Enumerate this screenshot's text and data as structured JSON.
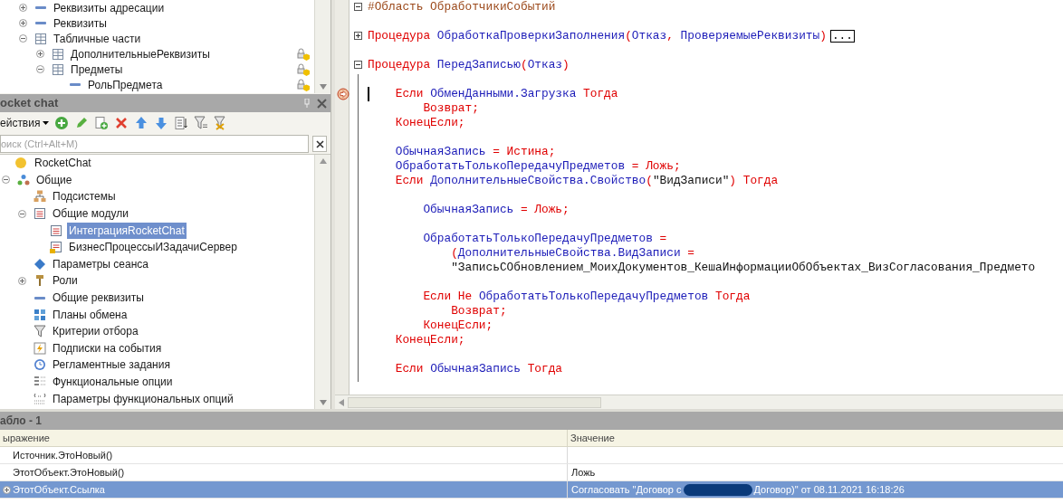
{
  "metadata_tree": {
    "items": [
      {
        "label": "Реквизиты адресации",
        "kind": "attribute",
        "expanded": false
      },
      {
        "label": "Реквизиты",
        "kind": "attribute",
        "expanded": false
      },
      {
        "label": "Табличные части",
        "kind": "table",
        "expanded": true,
        "children": [
          {
            "label": "ДополнительныеРеквизиты",
            "kind": "table",
            "expanded": false,
            "locked": true
          },
          {
            "label": "Предметы",
            "kind": "table",
            "expanded": true,
            "locked": true,
            "children": [
              {
                "label": "РольПредмета",
                "kind": "attribute",
                "locked": true
              }
            ]
          }
        ]
      }
    ]
  },
  "rocket_panel": {
    "title": "ocket chat",
    "actions_menu": "ействия",
    "search": {
      "placeholder": "оиск (Ctrl+Alt+M)"
    },
    "tree": [
      {
        "label": "RocketChat",
        "kind": "config",
        "selected": false,
        "children": [
          {
            "label": "Общие",
            "kind": "common",
            "expanded": true,
            "selected": false,
            "children": [
              {
                "label": "Подсистемы",
                "kind": "subsystems",
                "selected": false
              },
              {
                "label": "Общие модули",
                "kind": "module",
                "expanded": true,
                "selected": false,
                "children": [
                  {
                    "label": "ИнтеграцияRocketChat",
                    "kind": "module",
                    "selected": true
                  },
                  {
                    "label": "БизнесПроцессыИЗадачиСервер",
                    "kind": "module-server",
                    "selected": false
                  }
                ]
              },
              {
                "label": "Параметры сеанса",
                "kind": "session",
                "selected": false
              },
              {
                "label": "Роли",
                "kind": "role",
                "expanded": false,
                "selected": false
              },
              {
                "label": "Общие реквизиты",
                "kind": "attribute",
                "selected": false
              },
              {
                "label": "Планы обмена",
                "kind": "exchange",
                "selected": false
              },
              {
                "label": "Критерии отбора",
                "kind": "filter",
                "selected": false
              },
              {
                "label": "Подписки на события",
                "kind": "event",
                "selected": false
              },
              {
                "label": "Регламентные задания",
                "kind": "clock",
                "selected": false
              },
              {
                "label": "Функциональные опции",
                "kind": "options",
                "selected": false
              },
              {
                "label": "Параметры функциональных опций",
                "kind": "option-params",
                "selected": false
              }
            ]
          }
        ]
      }
    ]
  },
  "code_editor": {
    "lines": [
      {
        "kind": "code",
        "folded": false,
        "tokens": [
          {
            "kind": "region",
            "text": "#Область ОбработчикиСобытий"
          }
        ]
      },
      {
        "kind": "blank"
      },
      {
        "kind": "code",
        "folded": true,
        "tokens": [
          {
            "kind": "keyword",
            "text": "Процедура "
          },
          {
            "kind": "name",
            "text": "ОбработкаПроверкиЗаполнения"
          },
          {
            "kind": "keyword",
            "text": "("
          },
          {
            "kind": "name",
            "text": "Отказ"
          },
          {
            "kind": "keyword",
            "text": ", "
          },
          {
            "kind": "name",
            "text": "ПроверяемыеРеквизиты"
          },
          {
            "kind": "keyword",
            "text": ")"
          },
          {
            "kind": "collapsed",
            "text": "..."
          }
        ]
      },
      {
        "kind": "blank"
      },
      {
        "kind": "code",
        "folded": false,
        "tokens": [
          {
            "kind": "keyword",
            "text": "Процедура "
          },
          {
            "kind": "name",
            "text": "ПередЗаписью"
          },
          {
            "kind": "keyword",
            "text": "("
          },
          {
            "kind": "name",
            "text": "Отказ"
          },
          {
            "kind": "keyword",
            "text": ")"
          }
        ]
      },
      {
        "kind": "blank"
      },
      {
        "kind": "code",
        "breakpoint": true,
        "cursor": true,
        "tokens": [
          {
            "kind": "keyword",
            "text": "    Если "
          },
          {
            "kind": "name",
            "text": "ОбменДанными.Загрузка"
          },
          {
            "kind": "keyword",
            "text": " Тогда"
          }
        ]
      },
      {
        "kind": "code",
        "tokens": [
          {
            "kind": "keyword",
            "text": "        Возврат;"
          }
        ]
      },
      {
        "kind": "code",
        "tokens": [
          {
            "kind": "keyword",
            "text": "    КонецЕсли;"
          }
        ]
      },
      {
        "kind": "blank"
      },
      {
        "kind": "code",
        "tokens": [
          {
            "kind": "name",
            "text": "    ОбычнаяЗапись"
          },
          {
            "kind": "keyword",
            "text": " = Истина;"
          }
        ]
      },
      {
        "kind": "code",
        "tokens": [
          {
            "kind": "name",
            "text": "    ОбработатьТолькоПередачуПредметов"
          },
          {
            "kind": "keyword",
            "text": " = Ложь;"
          }
        ]
      },
      {
        "kind": "code",
        "tokens": [
          {
            "kind": "keyword",
            "text": "    Если "
          },
          {
            "kind": "name",
            "text": "ДополнительныеСвойства.Свойство"
          },
          {
            "kind": "keyword",
            "text": "("
          },
          {
            "kind": "string",
            "text": "\"ВидЗаписи\""
          },
          {
            "kind": "keyword",
            "text": ") Тогда"
          }
        ]
      },
      {
        "kind": "blank"
      },
      {
        "kind": "code",
        "tokens": [
          {
            "kind": "name",
            "text": "        ОбычнаяЗапись"
          },
          {
            "kind": "keyword",
            "text": " = Ложь;"
          }
        ]
      },
      {
        "kind": "blank"
      },
      {
        "kind": "code",
        "tokens": [
          {
            "kind": "name",
            "text": "        ОбработатьТолькоПередачуПредметов"
          },
          {
            "kind": "keyword",
            "text": " ="
          }
        ]
      },
      {
        "kind": "code",
        "tokens": [
          {
            "kind": "keyword",
            "text": "            ("
          },
          {
            "kind": "name",
            "text": "ДополнительныеСвойства.ВидЗаписи"
          },
          {
            "kind": "keyword",
            "text": " ="
          }
        ]
      },
      {
        "kind": "code",
        "tokens": [
          {
            "kind": "string",
            "text": "            \"ЗаписьСОбновлением_МоихДокументов_КешаИнформацииОбОбъектах_ВизСогласования_Предмето"
          }
        ]
      },
      {
        "kind": "blank"
      },
      {
        "kind": "code",
        "tokens": [
          {
            "kind": "keyword",
            "text": "        Если Не "
          },
          {
            "kind": "name",
            "text": "ОбработатьТолькоПередачуПредметов"
          },
          {
            "kind": "keyword",
            "text": " Тогда"
          }
        ]
      },
      {
        "kind": "code",
        "tokens": [
          {
            "kind": "keyword",
            "text": "            Возврат;"
          }
        ]
      },
      {
        "kind": "code",
        "tokens": [
          {
            "kind": "keyword",
            "text": "        КонецЕсли;"
          }
        ]
      },
      {
        "kind": "code",
        "tokens": [
          {
            "kind": "keyword",
            "text": "    КонецЕсли;"
          }
        ]
      },
      {
        "kind": "blank"
      },
      {
        "kind": "code",
        "tokens": [
          {
            "kind": "keyword",
            "text": "    Если "
          },
          {
            "kind": "name",
            "text": "ОбычнаяЗапись"
          },
          {
            "kind": "keyword",
            "text": " Тогда"
          }
        ]
      }
    ]
  },
  "watch_panel": {
    "title": "абло - 1",
    "columns": [
      "ыражение",
      "Значение"
    ],
    "rows": [
      {
        "expression": "Источник.ЭтоНовый()",
        "selected": false
      },
      {
        "expression": "ЭтотОбъект.ЭтоНовый()",
        "value": "Ложь",
        "selected": false
      },
      {
        "expression": "ЭтотОбъект.Ссылка",
        "expandable": true,
        "value": "Согласовать \"Договор с",
        "redacted": true,
        "value_after": "Договор)\" от 08.11.2021 16:18:26",
        "selected": true
      }
    ]
  }
}
